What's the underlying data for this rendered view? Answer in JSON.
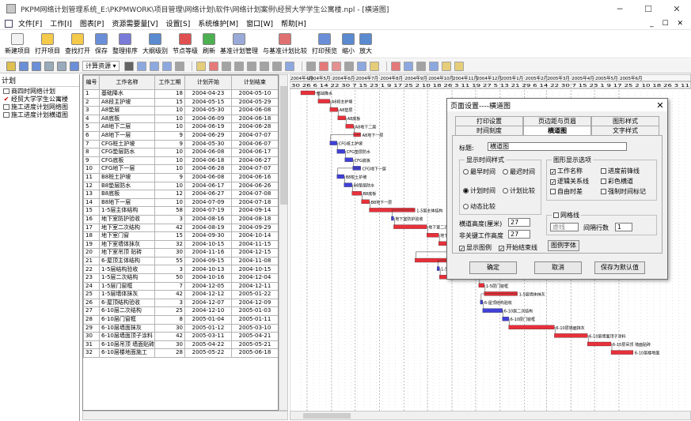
{
  "window": {
    "title": "PKPM网络计划管理系统_E:\\PKPMWORK\\项目管理\\网络计划\\软件\\网络计划案例\\经贸大学学生公寓楼.npl - [横道图]",
    "minimize": "─",
    "maximize": "☐",
    "close": "✕"
  },
  "menu": {
    "items": [
      "文件[F]",
      "工作[I]",
      "图表[P]",
      "资源需要量[V]",
      "设置[S]",
      "系统维护[M]",
      "窗口[W]",
      "帮助[H]"
    ],
    "mdi_controls": "_ ☐ ✕"
  },
  "toolbar": {
    "buttons": [
      {
        "label": "新建项目",
        "icon": "new-file-icon",
        "color": "#f2f2f2"
      },
      {
        "label": "打开项目",
        "icon": "open-folder-icon",
        "color": "#f5c94a"
      },
      {
        "label": "查找打开",
        "icon": "search-open-icon",
        "color": "#f5c94a"
      },
      {
        "label": "保存",
        "icon": "save-icon",
        "color": "#6a8fd8"
      },
      {
        "label": "整理排序",
        "icon": "sort-icon",
        "color": "#7a7ad8"
      },
      {
        "label": "大纲级别",
        "icon": "outline-icon",
        "color": "#5a8ad0"
      },
      {
        "label": "节点等级",
        "icon": "node-level-icon",
        "color": "#e05050"
      },
      {
        "label": "刷新",
        "icon": "refresh-icon",
        "color": "#4caf50"
      },
      {
        "label": "基准计划管理",
        "icon": "baseline-manage-icon",
        "color": "#9aaad8"
      },
      {
        "label": "与基准计划比较",
        "icon": "baseline-compare-icon",
        "color": "#e07070"
      },
      {
        "label": "打印预览",
        "icon": "print-preview-icon",
        "color": "#6a8fd8"
      },
      {
        "label": "缩小",
        "icon": "zoom-out-icon",
        "color": "#5a8ad0"
      },
      {
        "label": "放大",
        "icon": "zoom-in-icon",
        "color": "#5a8ad0"
      }
    ]
  },
  "toolbar2": {
    "dropdown": "计算资源 ▾"
  },
  "left_panel": {
    "header": "计划",
    "items": [
      "商四时网络计划",
      "经贸大学学生公寓楼",
      "施工进度计划网络图",
      "施工进度计划横道图"
    ]
  },
  "table": {
    "headers": [
      "编号",
      "工作名称",
      "工作工期",
      "计划开始",
      "计划结束"
    ],
    "rows": [
      [
        "1",
        "基础降水",
        "18",
        "2004-04-23",
        "2004-05-10"
      ],
      [
        "2",
        "A8段主护坡",
        "15",
        "2004-05-15",
        "2004-05-29"
      ],
      [
        "3",
        "A8垫层",
        "10",
        "2004-05-30",
        "2004-06-08"
      ],
      [
        "4",
        "A8底板",
        "10",
        "2004-06-09",
        "2004-06-18"
      ],
      [
        "5",
        "A8地下二层",
        "10",
        "2004-06-19",
        "2004-06-28"
      ],
      [
        "6",
        "A8地下一层",
        "9",
        "2004-06-29",
        "2004-07-07"
      ],
      [
        "7",
        "CFG桩土护坡",
        "9",
        "2004-05-30",
        "2004-06-07"
      ],
      [
        "8",
        "CFG垫层防水",
        "10",
        "2004-06-08",
        "2004-06-17"
      ],
      [
        "9",
        "CFG底板",
        "10",
        "2004-06-18",
        "2004-06-27"
      ],
      [
        "10",
        "CFG地下一层",
        "10",
        "2004-06-28",
        "2004-07-07"
      ],
      [
        "11",
        "B8桩土护坡",
        "9",
        "2004-06-08",
        "2004-06-16"
      ],
      [
        "12",
        "B8垫层防水",
        "10",
        "2004-06-17",
        "2004-06-26"
      ],
      [
        "13",
        "B8底板",
        "12",
        "2004-06-27",
        "2004-07-08"
      ],
      [
        "14",
        "B8地下一层",
        "10",
        "2004-07-09",
        "2004-07-18"
      ],
      [
        "15",
        "1-5层主体结构",
        "58",
        "2004-07-19",
        "2004-09-14"
      ],
      [
        "16",
        "地下室防护验收",
        "3",
        "2004-08-16",
        "2004-08-18"
      ],
      [
        "17",
        "地下室二次结构",
        "42",
        "2004-08-19",
        "2004-09-29"
      ],
      [
        "18",
        "地下室门窗",
        "15",
        "2004-09-30",
        "2004-10-14"
      ],
      [
        "19",
        "地下室墙体抹灰",
        "32",
        "2004-10-15",
        "2004-11-15"
      ],
      [
        "20",
        "地下室吊顶 贴砖",
        "30",
        "2004-11-16",
        "2004-12-15"
      ],
      [
        "21",
        "6-屋顶主体结构",
        "55",
        "2004-09-15",
        "2004-11-08"
      ],
      [
        "22",
        "1-5层结构验收",
        "3",
        "2004-10-13",
        "2004-10-15"
      ],
      [
        "23",
        "1-5层二次结构",
        "50",
        "2004-10-16",
        "2004-12-04"
      ],
      [
        "24",
        "1-5层门窗框",
        "7",
        "2004-12-05",
        "2004-12-11"
      ],
      [
        "25",
        "1-5层墙体抹灰",
        "42",
        "2004-12-12",
        "2005-01-22"
      ],
      [
        "26",
        "6-屋顶结构验收",
        "3",
        "2004-12-07",
        "2004-12-09"
      ],
      [
        "27",
        "6-10层二次结构",
        "25",
        "2004-12-10",
        "2005-01-03"
      ],
      [
        "28",
        "6-10层门窗框",
        "8",
        "2005-01-04",
        "2005-01-11"
      ],
      [
        "29",
        "6-10层墙面抹灰",
        "30",
        "2005-01-12",
        "2005-03-10"
      ],
      [
        "30",
        "6-10层墙面顶子涂料",
        "42",
        "2005-03-11",
        "2005-04-21"
      ],
      [
        "31",
        "6-10层吊顶 墙面贴砖",
        "30",
        "2005-04-22",
        "2005-05-21"
      ],
      [
        "32",
        "6-10层楼地面施工",
        "28",
        "2005-05-22",
        "2005-06-18"
      ]
    ]
  },
  "gantt": {
    "months": [
      "2004年4月",
      "2004年5月",
      "2004年6月",
      "2004年7月",
      "2004年8月",
      "2004年9月",
      "2004年10月",
      "2004年11月",
      "2004年12月",
      "2005年1月",
      "2005年2月",
      "2005年3月",
      "2005年4月",
      "2005年5月",
      "2005年6月"
    ],
    "day_ticks": "30 26 6 14 22 30 7 15 23 1 9 17 25 2 10 18 26 3 11 19 27 5 13 21 29 6 14 22 30 7 15 23 1 9 17 25 2 10 18 26 3 11",
    "critical_color": "#e8303a",
    "noncritical_color": "#4040d8",
    "critical_ids": [
      1,
      2,
      3,
      4,
      5,
      6,
      13,
      14,
      15,
      17,
      18,
      19,
      20,
      21,
      23,
      24,
      25,
      29,
      30,
      31,
      32
    ],
    "bar_labels": [
      "基础降水",
      "A8段主护坡",
      "A8垫层",
      "A8底板",
      "A8地下二层",
      "A8地下一层",
      "CFG桩土护坡",
      "CFG垫层防水",
      "CFG底板",
      "CFG地下一层",
      "B8桩土护坡",
      "B8垫层防水",
      "B8底板",
      "B8地下一层",
      "1-5层主体结构",
      "地下室防护验收",
      "地下室二次结构",
      "地下室门窗",
      "地下室墙体抹灰",
      "地下室吊顶 贴砖",
      "6-屋顶主体结构",
      "1-5层结构验收",
      "1-5层二次结构",
      "1-5层门窗框",
      "1-5层墙体抹灰",
      "6-屋顶结构验收",
      "6-10层二次结构",
      "6-10层门窗框",
      "6-10层墙面抹灰",
      "6-10层墙面顶子涂料",
      "6-10层吊顶 墙面贴砖",
      "6-10层楼地面"
    ]
  },
  "dialog": {
    "title": "页面设置----横道图",
    "close": "✕",
    "tabs_row1": [
      "打印设置",
      "页边距与页眉",
      "图形样式"
    ],
    "tabs_row2": [
      "时间刻度",
      "横道图",
      "文字样式"
    ],
    "caption_label": "标题:",
    "caption_value": "横道图",
    "time_group": "显示时间样式",
    "radio_earliest": "最早时间",
    "radio_latest": "最迟时间",
    "radio_plan": "计划时间",
    "radio_compare": "计划比较",
    "radio_dynamic": "动态比较",
    "options_group": "图形显示选项",
    "opt_work_name": "工作名称",
    "opt_progress_line": "进度前锋线",
    "opt_logic": "逻辑关系线",
    "opt_color": "彩色横道",
    "opt_free_time": "自由时差",
    "opt_force_mark": "强制时间标记",
    "bar_height_label": "横道高度(厘米)",
    "bar_height_value": "27",
    "noncrit_height_label": "非关键工作高度",
    "noncrit_height_value": "27",
    "grid_group": "网格线",
    "grid_line_style": "虚线",
    "grid_interval_label": "间隔行数",
    "grid_interval_value": "1",
    "show_legend": "显示图例",
    "show_start_end": "开始结束线",
    "legend_font": "图例字体",
    "ok": "确定",
    "cancel": "取消",
    "save_default": "保存为默认值"
  }
}
